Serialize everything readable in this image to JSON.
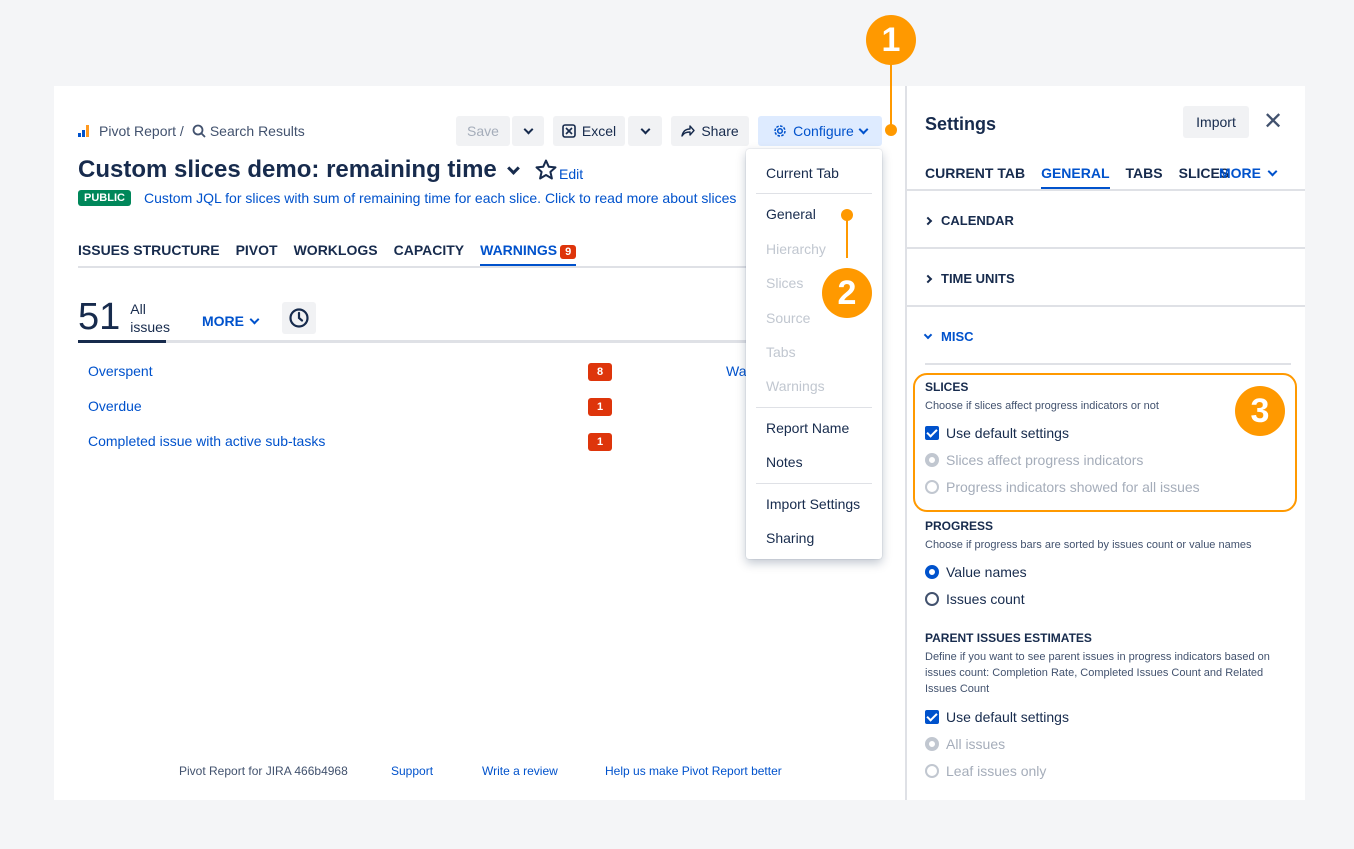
{
  "breadcrumb": {
    "app": "Pivot Report /",
    "search": "Search Results"
  },
  "toolbar": {
    "save": "Save",
    "excel": "Excel",
    "share": "Share",
    "configure": "Configure"
  },
  "report": {
    "title": "Custom slices demo: remaining time",
    "edit": "Edit",
    "badge": "PUBLIC",
    "description": "Custom JQL for slices with sum of remaining time for each slice. Click to read more about slices"
  },
  "tabs": [
    {
      "label": "ISSUES STRUCTURE"
    },
    {
      "label": "PIVOT"
    },
    {
      "label": "WORKLOGS"
    },
    {
      "label": "CAPACITY"
    },
    {
      "label": "WARNINGS",
      "count": "9"
    }
  ],
  "summary": {
    "count": "51",
    "label_line1": "All",
    "label_line2": "issues",
    "more": "MORE"
  },
  "warnings": [
    {
      "label": "Overspent",
      "count": "8"
    },
    {
      "label": "Overdue",
      "count": "1"
    },
    {
      "label": "Completed issue with active sub-tasks",
      "count": "1"
    }
  ],
  "cut_text": "Wa",
  "footer": {
    "version": "Pivot Report for JIRA 466b4968",
    "support": "Support",
    "review": "Write a review",
    "help": "Help us make Pivot Report better"
  },
  "menu": {
    "current_tab": "Current Tab",
    "general": "General",
    "hierarchy": "Hierarchy",
    "slices": "Slices",
    "source": "Source",
    "tabs": "Tabs",
    "warnings": "Warnings",
    "report_name": "Report Name",
    "notes": "Notes",
    "import_settings": "Import Settings",
    "sharing": "Sharing"
  },
  "settings": {
    "title": "Settings",
    "import": "Import",
    "tabs": [
      "CURRENT TAB",
      "GENERAL",
      "TABS",
      "SLICES"
    ],
    "more": "MORE",
    "sections": {
      "calendar": "CALENDAR",
      "time_units": "TIME UNITS",
      "misc": "MISC"
    },
    "slices": {
      "heading": "SLICES",
      "desc": "Choose if slices affect progress indicators or not",
      "default": "Use default settings",
      "opt1": "Slices affect progress indicators",
      "opt2": "Progress indicators showed for all issues"
    },
    "progress": {
      "heading": "PROGRESS",
      "desc": "Choose if progress bars are sorted by issues count or value names",
      "opt1": "Value names",
      "opt2": "Issues count"
    },
    "parent": {
      "heading": "PARENT ISSUES ESTIMATES",
      "desc": "Define if you want to see parent issues in progress indicators based on issues count: Completion Rate, Completed Issues Count and Related Issues Count",
      "default": "Use default settings",
      "opt1": "All issues",
      "opt2": "Leaf issues only"
    }
  },
  "callouts": [
    "1",
    "2",
    "3"
  ],
  "colors": {
    "accent": "#0052cc",
    "annotation": "#ff9900",
    "danger": "#de350b",
    "success": "#00875a"
  }
}
